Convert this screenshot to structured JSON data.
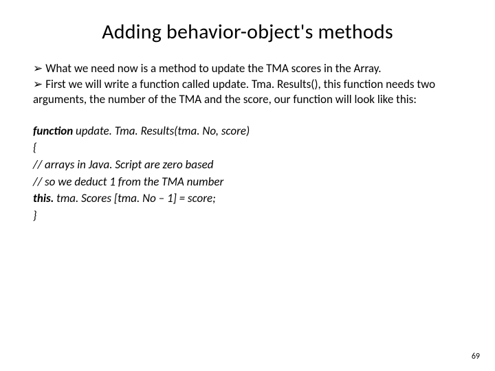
{
  "title": "Adding behavior-object's methods",
  "bullets": {
    "b1": "What we need now is a method to update the TMA scores in the Array.",
    "b2": "First we will write a function called update. Tma. Results(), this function needs two arguments, the number of the TMA and the score, our function will look like this:"
  },
  "code": {
    "kw_function": "function",
    "sig_rest": " update. Tma. Results(tma. No, score)",
    "open": "{",
    "c1": "// arrays in Java. Script are zero based",
    "c2": "// so we deduct 1 from the TMA number",
    "kw_this": "this.",
    "assign_rest": " tma. Scores [tma. No – 1] = score;",
    "close": "}"
  },
  "glyphs": {
    "arrow": "➢"
  },
  "page": "69"
}
